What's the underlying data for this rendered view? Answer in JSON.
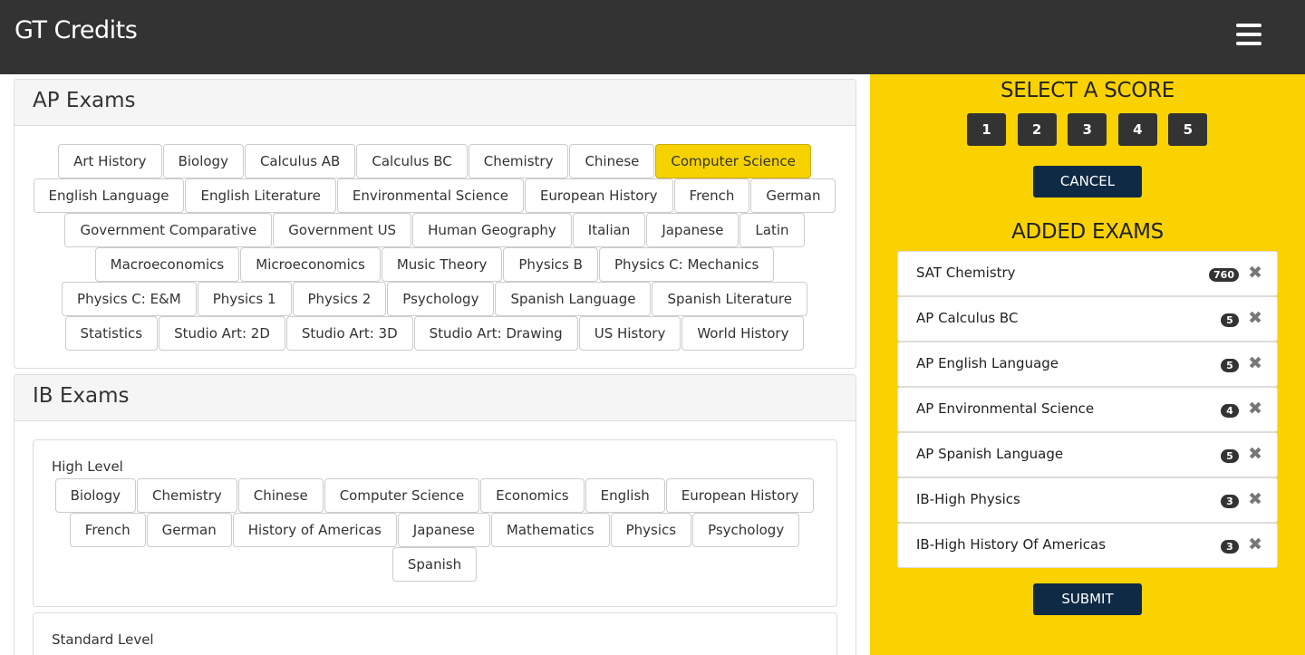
{
  "app": {
    "title": "GT Credits",
    "menu_icon": "hamburger-icon"
  },
  "ap_exams": {
    "heading": "AP Exams",
    "rows": [
      [
        "Art History",
        "Biology",
        "Calculus AB",
        "Calculus BC",
        "Chemistry",
        "Chinese",
        "Computer Science"
      ],
      [
        "English Language",
        "English Literature",
        "Environmental Science",
        "European History",
        "French",
        "German"
      ],
      [
        "Government Comparative",
        "Government US",
        "Human Geography",
        "Italian",
        "Japanese",
        "Latin"
      ],
      [
        "Macroeconomics",
        "Microeconomics",
        "Music Theory",
        "Physics B",
        "Physics C: Mechanics"
      ],
      [
        "Physics C: E&M",
        "Physics 1",
        "Physics 2",
        "Psychology",
        "Spanish Language",
        "Spanish Literature"
      ],
      [
        "Statistics",
        "Studio Art: 2D",
        "Studio Art: 3D",
        "Studio Art: Drawing",
        "US History",
        "World History"
      ]
    ],
    "selected": "Computer Science"
  },
  "ib_exams": {
    "heading": "IB Exams",
    "high_level": {
      "title": "High Level",
      "rows": [
        [
          "Biology",
          "Chemistry",
          "Chinese",
          "Computer Science",
          "Economics",
          "English",
          "European History"
        ],
        [
          "French",
          "German",
          "History of Americas",
          "Japanese",
          "Mathematics",
          "Physics",
          "Psychology"
        ],
        [
          "Spanish"
        ]
      ]
    },
    "standard_level": {
      "title": "Standard Level"
    }
  },
  "score_panel": {
    "title": "SELECT A SCORE",
    "scores": [
      "1",
      "2",
      "3",
      "4",
      "5"
    ],
    "cancel_label": "CANCEL",
    "added_title": "ADDED EXAMS",
    "added": [
      {
        "name": "SAT Chemistry",
        "score": "760"
      },
      {
        "name": "AP Calculus BC",
        "score": "5"
      },
      {
        "name": "AP English Language",
        "score": "5"
      },
      {
        "name": "AP Environmental Science",
        "score": "4"
      },
      {
        "name": "AP Spanish Language",
        "score": "5"
      },
      {
        "name": "IB-High Physics",
        "score": "3"
      },
      {
        "name": "IB-High History Of Americas",
        "score": "3"
      }
    ],
    "remove_icon": "close-icon",
    "submit_label": "SUBMIT"
  },
  "colors": {
    "accent": "#fad201",
    "navbar": "#333333",
    "dark_button": "#0f2a45"
  }
}
